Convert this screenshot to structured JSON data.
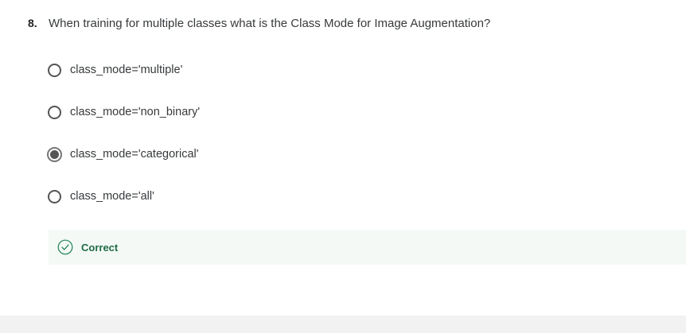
{
  "question": {
    "number": "8.",
    "text": "When training for multiple classes what is the Class Mode for Image Augmentation?"
  },
  "options": [
    {
      "label": "class_mode='multiple'",
      "selected": false
    },
    {
      "label": "class_mode='non_binary'",
      "selected": false
    },
    {
      "label": "class_mode='categorical'",
      "selected": true
    },
    {
      "label": "class_mode='all'",
      "selected": false
    }
  ],
  "feedback": {
    "label": "Correct",
    "icon": "check-circle-icon",
    "color": "#1f8354"
  }
}
